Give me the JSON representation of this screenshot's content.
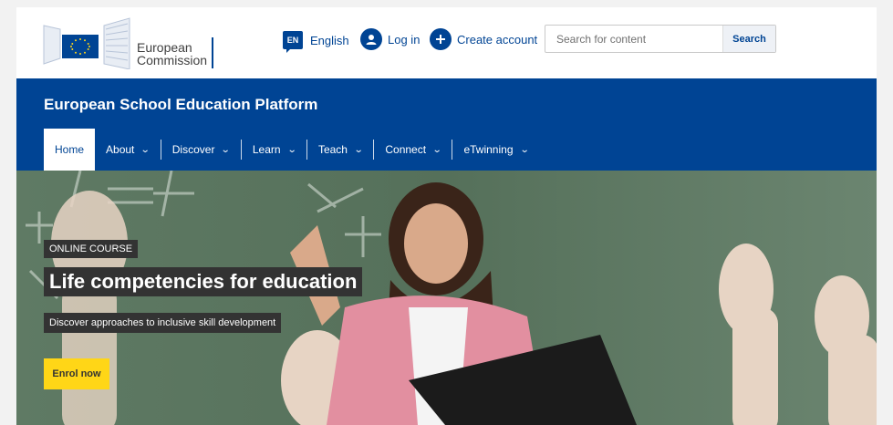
{
  "header": {
    "logo_text_line1": "European",
    "logo_text_line2": "Commission",
    "lang_code": "EN",
    "lang_label": "English",
    "login_label": "Log in",
    "create_label": "Create account",
    "search_placeholder": "Search for content",
    "search_button": "Search"
  },
  "site": {
    "title": "European School Education Platform"
  },
  "nav": {
    "items": [
      {
        "label": "Home",
        "active": true
      },
      {
        "label": "About",
        "chevron": "chevron-down-icon"
      },
      {
        "label": "Discover",
        "chevron": "chevron-down-icon"
      },
      {
        "label": "Learn",
        "chevron": "chevron-down-icon"
      },
      {
        "label": "Teach",
        "chevron": "chevron-down-icon"
      },
      {
        "label": "Connect",
        "chevron": "chevron-down-icon"
      },
      {
        "label": "eTwinning",
        "chevron": "chevron-down-icon"
      }
    ]
  },
  "hero": {
    "tag": "ONLINE COURSE",
    "headline": "Life competencies for education",
    "subtitle": "Discover approaches to inclusive skill development",
    "cta": "Enrol now"
  },
  "colors": {
    "brand_blue": "#004494",
    "cta_yellow": "#ffd617",
    "label_bg": "#333333"
  }
}
